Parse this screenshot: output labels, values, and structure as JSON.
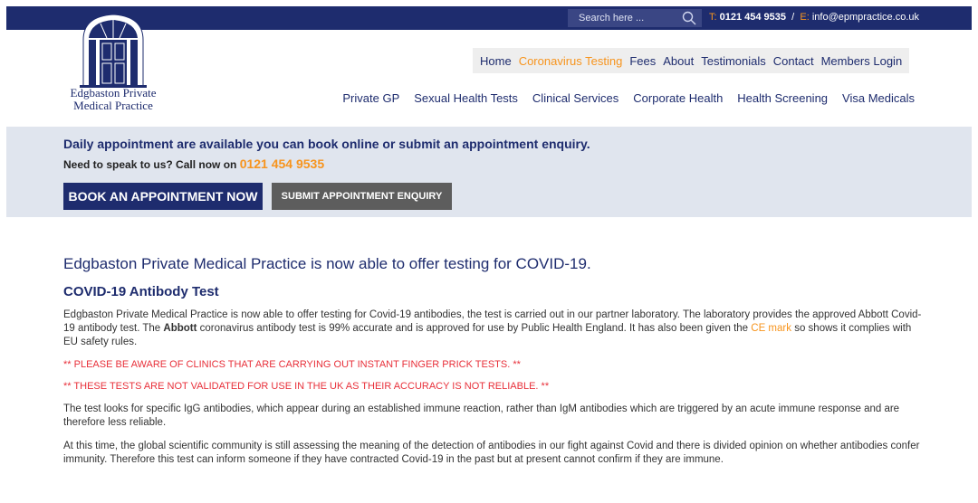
{
  "topbar": {
    "search_placeholder": "Search here ...",
    "phone_prefix": "T:",
    "phone": "0121 454 9535",
    "separator": "/",
    "email_prefix": "E:",
    "email": "info@epmpractice.co.uk"
  },
  "logo": {
    "line1": "Edgbaston Private",
    "line2": "Medical Practice"
  },
  "nav_primary": [
    {
      "label": "Home"
    },
    {
      "label": "Coronavirus Testing"
    },
    {
      "label": "Fees"
    },
    {
      "label": "About"
    },
    {
      "label": "Testimonials"
    },
    {
      "label": "Contact"
    },
    {
      "label": "Members Login"
    }
  ],
  "nav_secondary": [
    {
      "label": "Private GP"
    },
    {
      "label": "Sexual Health Tests"
    },
    {
      "label": "Clinical Services"
    },
    {
      "label": "Corporate Health"
    },
    {
      "label": "Health Screening"
    },
    {
      "label": "Visa Medicals"
    }
  ],
  "banner": {
    "line1": "Daily appointment are available you can book online or submit an appointment enquiry.",
    "line2_prefix": "Need to speak to us? Call now on",
    "phone": "0121 454 9535",
    "book_label": "BOOK AN APPOINTMENT NOW",
    "enquiry_label": "SUBMIT APPOINTMENT ENQUIRY"
  },
  "content": {
    "heading": "Edgbaston Private Medical Practice is now able to offer testing for COVID-19.",
    "subheading": "COVID-19 Antibody Test",
    "p1_a": "Edgbaston Private Medical Practice is now able to offer testing for Covid-19 antibodies, the test is carried out in our partner laboratory. The laboratory provides the approved Abbott Covid-19 antibody test. The",
    "p1_bold": "Abbott",
    "p1_b": "coronavirus antibody test is 99% accurate and is approved for use by Public Health England. It has also been given the",
    "p1_link": "CE mark",
    "p1_c": "so shows it complies with EU safety rules.",
    "warning1": "** PLEASE BE AWARE OF CLINICS THAT ARE CARRYING OUT INSTANT FINGER PRICK TESTS. **",
    "warning2": "** THESE TESTS ARE NOT VALIDATED FOR USE IN THE UK AS THEIR ACCURACY IS NOT RELIABLE. **",
    "p2": "The test looks for specific IgG antibodies, which appear during an established immune reaction, rather than IgM antibodies which are triggered by an acute immune response and are therefore less reliable.",
    "p3": "At this time, the global scientific community is still assessing the meaning of the detection of antibodies in our fight against Covid and there is divided opinion on whether antibodies confer immunity. Therefore this test can inform someone if they have contracted Covid-19 in the past but at present cannot confirm if they are immune."
  },
  "colors": {
    "navy": "#1e2c6e",
    "orange": "#f7941d",
    "warning_red": "#e8303a",
    "band": "#e0e5ee"
  }
}
